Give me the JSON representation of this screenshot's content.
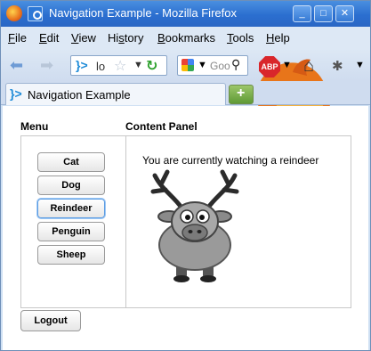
{
  "window": {
    "title": "Navigation Example - Mozilla Firefox",
    "controls": {
      "minimize": "_",
      "maximize": "□",
      "close": "✕"
    }
  },
  "menubar": {
    "items": [
      {
        "label": "File",
        "mnemonic": "F"
      },
      {
        "label": "Edit",
        "mnemonic": "E"
      },
      {
        "label": "View",
        "mnemonic": "V"
      },
      {
        "label": "History",
        "mnemonic": "s"
      },
      {
        "label": "Bookmarks",
        "mnemonic": "B"
      },
      {
        "label": "Tools",
        "mnemonic": "T"
      },
      {
        "label": "Help",
        "mnemonic": "H"
      }
    ]
  },
  "navbar": {
    "url_text": "lo",
    "search_placeholder": "Goo",
    "adblock_label": "ABP"
  },
  "tabs": [
    {
      "label": "Navigation Example"
    }
  ],
  "page": {
    "menu_header": "Menu",
    "content_header": "Content Panel",
    "animal_buttons": [
      "Cat",
      "Dog",
      "Reindeer",
      "Penguin",
      "Sheep"
    ],
    "active_button": "Reindeer",
    "content_text": "You are currently watching a reindeer",
    "logout_label": "Logout"
  },
  "colors": {
    "titlebar": "#2b6fd0",
    "chrome": "#dde8f5",
    "active_button_border": "#5a9be2"
  }
}
